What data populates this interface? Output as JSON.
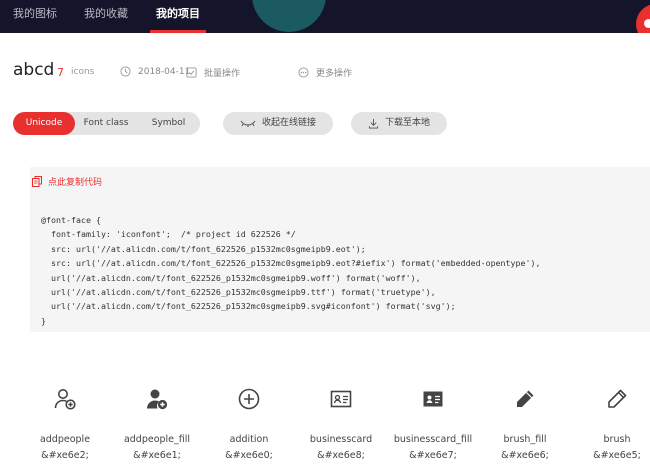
{
  "nav": {
    "tabs": [
      {
        "label": "我的图标"
      },
      {
        "label": "我的收藏"
      },
      {
        "label": "我的项目"
      }
    ],
    "active_index": 2
  },
  "project": {
    "title": "abcd",
    "icon_count": "7",
    "icon_count_unit": "icons",
    "date": "2018-04-11",
    "batch_ops": "批量操作",
    "more_ops": "更多操作"
  },
  "toolbar": {
    "segments": [
      "Unicode",
      "Font class",
      "Symbol"
    ],
    "active_segment": "Unicode",
    "collapse_link": "收起在线链接",
    "download": "下载至本地"
  },
  "code_panel": {
    "copy_label": "点此复制代码",
    "code": "@font-face {\n  font-family: 'iconfont';  /* project id 622526 */\n  src: url('//at.alicdn.com/t/font_622526_p1532mc0sgmeipb9.eot');\n  src: url('//at.alicdn.com/t/font_622526_p1532mc0sgmeipb9.eot?#iefix') format('embedded-opentype'),\n  url('//at.alicdn.com/t/font_622526_p1532mc0sgmeipb9.woff') format('woff'),\n  url('//at.alicdn.com/t/font_622526_p1532mc0sgmeipb9.ttf') format('truetype'),\n  url('//at.alicdn.com/t/font_622526_p1532mc0sgmeipb9.svg#iconfont') format('svg');\n}"
  },
  "icons": [
    {
      "name": "addpeople",
      "code": "&#xe6e2;",
      "icon": "add-person-icon"
    },
    {
      "name": "addpeople_fill",
      "code": "&#xe6e1;",
      "icon": "add-person-fill-icon"
    },
    {
      "name": "addition",
      "code": "&#xe6e0;",
      "icon": "circle-plus-icon"
    },
    {
      "name": "businesscard",
      "code": "&#xe6e8;",
      "icon": "business-card-icon"
    },
    {
      "name": "businesscard_fill",
      "code": "&#xe6e7;",
      "icon": "business-card-fill-icon"
    },
    {
      "name": "brush_fill",
      "code": "&#xe6e6;",
      "icon": "brush-fill-icon"
    },
    {
      "name": "brush",
      "code": "&#xe6e5;",
      "icon": "brush-icon"
    }
  ],
  "colors": {
    "accent": "#e8302e",
    "nav_bg": "#14142a"
  }
}
